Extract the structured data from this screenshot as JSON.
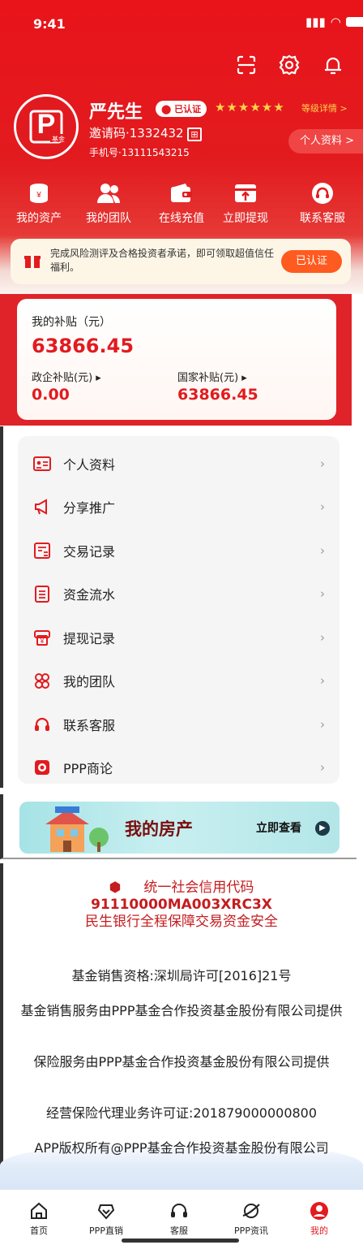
{
  "status_bar": {
    "time": "9:41"
  },
  "user": {
    "name": "严先生",
    "verified": "已认证",
    "stars": "★★★★★★",
    "level_link": "等级详情 >",
    "invite_code": "邀请码·1332432",
    "phone": "手机号·13111543215",
    "profile_button": "个人资料 >",
    "avatar_sub": "基金"
  },
  "quick_actions": [
    {
      "label": "我的资产",
      "icon": "coins-icon"
    },
    {
      "label": "我的团队",
      "icon": "team-icon"
    },
    {
      "label": "在线充值",
      "icon": "wallet-icon"
    },
    {
      "label": "立即提现",
      "icon": "withdraw-icon"
    },
    {
      "label": "联系客服",
      "icon": "headset-icon"
    }
  ],
  "notice": {
    "text": "完成风险测评及合格投资者承诺，即可领取超值信任福利。",
    "button": "已认证"
  },
  "subsidy": {
    "title": "我的补贴（元）",
    "total": "63866.45",
    "gov_label": "政企补贴(元) ▸",
    "gov_value": "0.00",
    "nation_label": "国家补贴(元) ▸",
    "nation_value": "63866.45"
  },
  "menu": [
    {
      "label": "个人资料",
      "icon": "id-card-icon"
    },
    {
      "label": "分享推广",
      "icon": "megaphone-icon"
    },
    {
      "label": "交易记录",
      "icon": "transaction-record-icon"
    },
    {
      "label": "资金流水",
      "icon": "ledger-icon"
    },
    {
      "label": "提现记录",
      "icon": "withdraw-record-icon"
    },
    {
      "label": "我的团队",
      "icon": "group-icon"
    },
    {
      "label": "联系客服",
      "icon": "support-icon"
    },
    {
      "label": "PPP商论",
      "icon": "chat-icon"
    }
  ],
  "banner": {
    "title": "我的房产",
    "link": "立即查看"
  },
  "info": {
    "credit_line1": "统一社会信用代码",
    "credit_line2": "91110000MA003XRC3X",
    "credit_line3": "民生银行全程保障交易资金安全",
    "lines": [
      "基金销售资格:深圳局许可[2016]21号",
      "基金销售服务由PPP基金合作投资基金股份有限公司提供",
      "保险服务由PPP基金合作投资基金股份有限公司提供",
      "经营保险代理业务许可证:201879000000800",
      "APP版权所有@PPP基金合作投资基金股份有限公司"
    ]
  },
  "tabs": [
    {
      "label": "首页",
      "icon": "home-icon"
    },
    {
      "label": "PPP直销",
      "icon": "direct-sales-icon"
    },
    {
      "label": "客服",
      "icon": "service-icon"
    },
    {
      "label": "PPP资讯",
      "icon": "news-icon"
    },
    {
      "label": "我的",
      "icon": "profile-icon",
      "active": true
    }
  ],
  "colors": {
    "brand_red": "#e21b1f",
    "gold": "#ffd34b",
    "notice_orange": "#ff5a1f"
  }
}
